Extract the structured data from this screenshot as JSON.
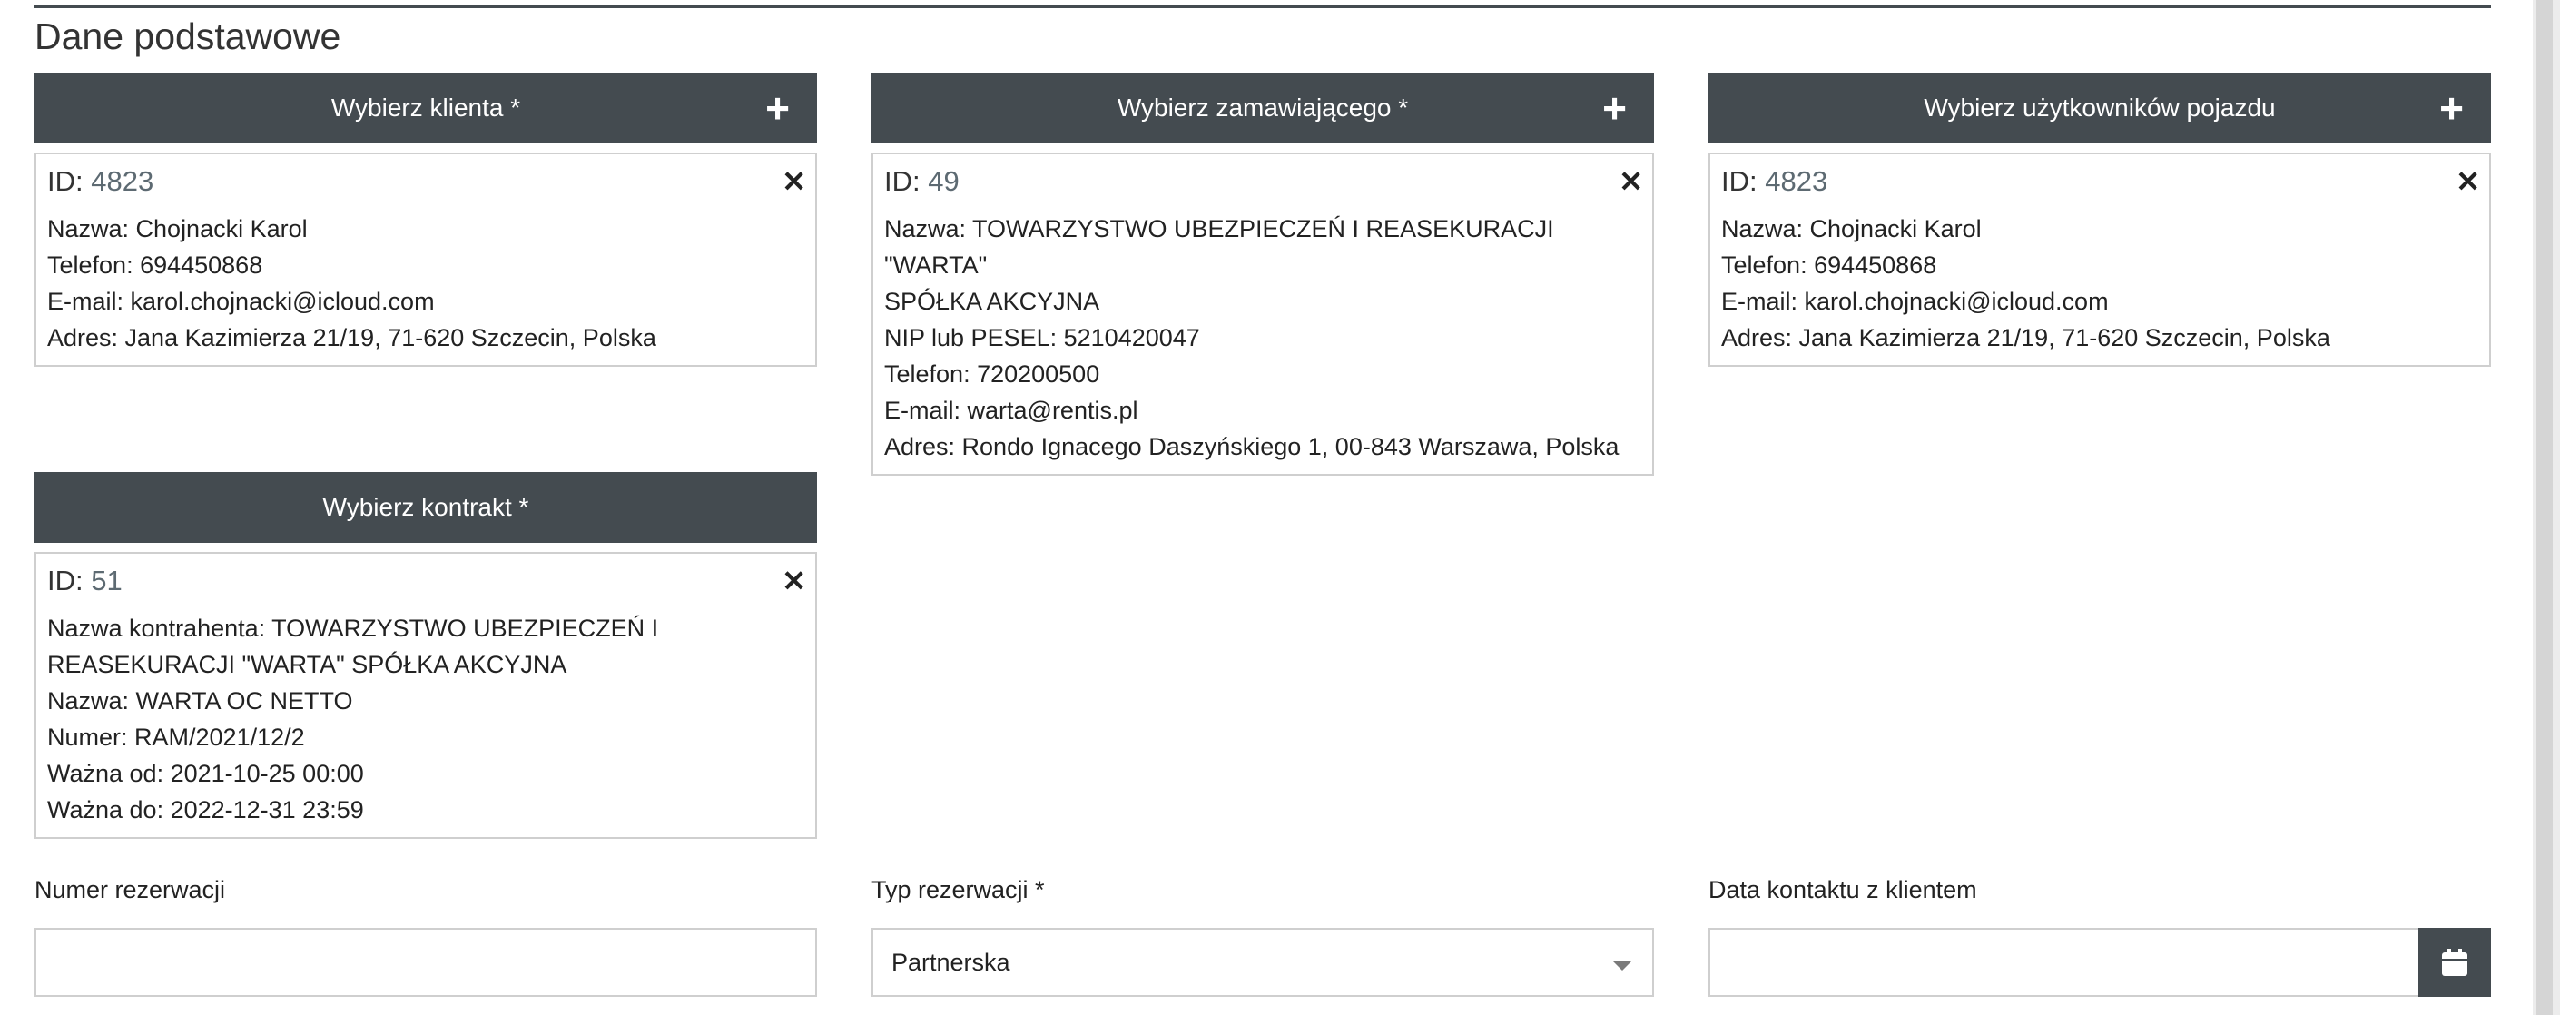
{
  "section": {
    "title": "Dane podstawowe"
  },
  "client": {
    "header": "Wybierz klienta *",
    "id_label": "ID:",
    "id_value": "4823",
    "lines": [
      "Nazwa: Chojnacki Karol",
      "Telefon: 694450868",
      "E-mail: karol.chojnacki@icloud.com",
      "Adres: Jana Kazimierza 21/19, 71-620 Szczecin, Polska"
    ]
  },
  "orderer": {
    "header": "Wybierz zamawiającego *",
    "id_label": "ID:",
    "id_value": "49",
    "lines": [
      "Nazwa: TOWARZYSTWO UBEZPIECZEŃ I REASEKURACJI \"WARTA\"",
      "SPÓŁKA AKCYJNA",
      "NIP lub PESEL: 5210420047",
      "Telefon: 720200500",
      "E-mail: warta@rentis.pl",
      "Adres: Rondo Ignacego Daszyńskiego 1, 00-843 Warszawa, Polska"
    ]
  },
  "vehicle_users": {
    "header": "Wybierz użytkowników pojazdu",
    "id_label": "ID:",
    "id_value": "4823",
    "lines": [
      "Nazwa: Chojnacki Karol",
      "Telefon: 694450868",
      "E-mail: karol.chojnacki@icloud.com",
      "Adres: Jana Kazimierza 21/19, 71-620 Szczecin, Polska"
    ]
  },
  "contract": {
    "header": "Wybierz kontrakt *",
    "id_label": "ID:",
    "id_value": "51",
    "lines": [
      "Nazwa kontrahenta: TOWARZYSTWO UBEZPIECZEŃ I",
      "REASEKURACJI \"WARTA\" SPÓŁKA AKCYJNA",
      "Nazwa: WARTA OC NETTO",
      "Numer: RAM/2021/12/2",
      "Ważna od: 2021-10-25 00:00",
      "Ważna do: 2022-12-31 23:59"
    ]
  },
  "fields": {
    "reservation_number": {
      "label": "Numer rezerwacji",
      "value": ""
    },
    "reservation_type": {
      "label": "Typ rezerwacji *",
      "value": "Partnerska"
    },
    "contact_date": {
      "label": "Data kontaktu z klientem",
      "value": ""
    }
  },
  "icons": {
    "add": "plus-icon",
    "remove": "close-icon",
    "calendar": "calendar-icon",
    "dropdown": "chevron-down-icon"
  },
  "colors": {
    "header_bg": "#444b50",
    "border": "#cfcfcf"
  }
}
